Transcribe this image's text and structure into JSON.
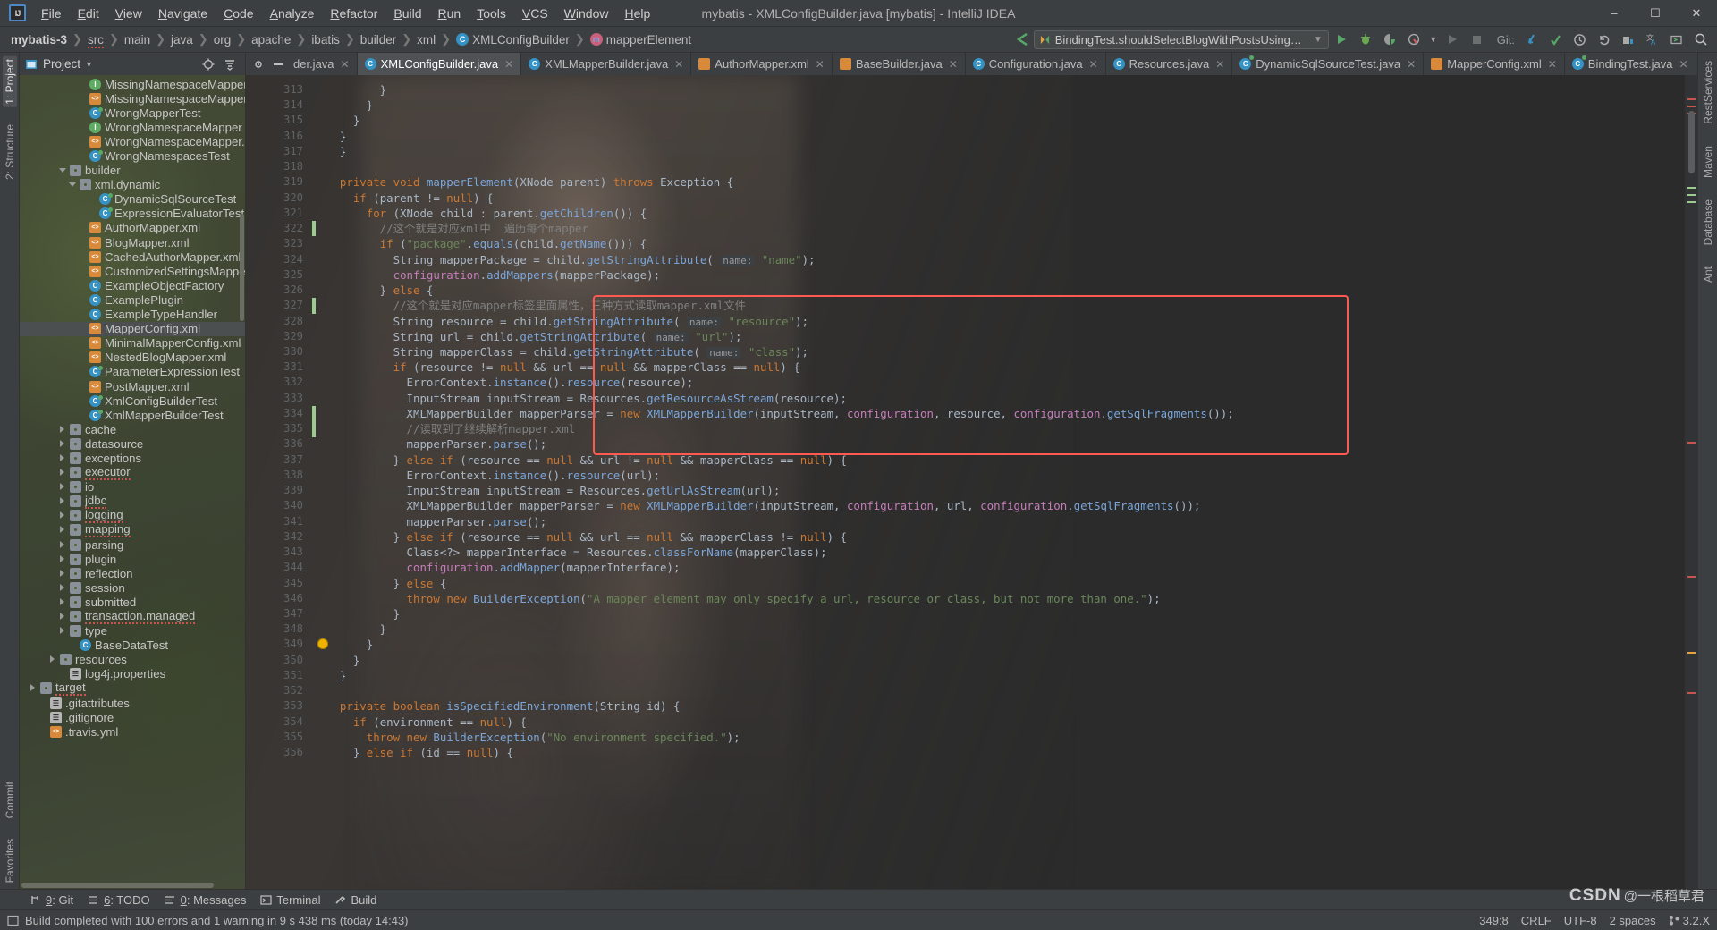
{
  "window": {
    "title": "mybatis - XMLConfigBuilder.java [mybatis] - IntelliJ IDEA",
    "minimize": "–",
    "maximize": "☐",
    "close": "✕",
    "logo": "IJ"
  },
  "menu": [
    "File",
    "Edit",
    "View",
    "Navigate",
    "Code",
    "Analyze",
    "Refactor",
    "Build",
    "Run",
    "Tools",
    "VCS",
    "Window",
    "Help"
  ],
  "breadcrumbs": [
    {
      "label": "mybatis-3",
      "type": "module"
    },
    {
      "label": "src",
      "type": "dir-underline"
    },
    {
      "label": "main",
      "type": "dir"
    },
    {
      "label": "java",
      "type": "dir"
    },
    {
      "label": "org",
      "type": "dir"
    },
    {
      "label": "apache",
      "type": "dir"
    },
    {
      "label": "ibatis",
      "type": "dir"
    },
    {
      "label": "builder",
      "type": "dir"
    },
    {
      "label": "xml",
      "type": "dir"
    },
    {
      "label": "XMLConfigBuilder",
      "type": "class"
    },
    {
      "label": "mapperElement",
      "type": "method"
    }
  ],
  "toolbar": {
    "run_configuration": "BindingTest.shouldSelectBlogWithPostsUsingSubSelect",
    "git_label": "Git:",
    "icons": [
      "run-icon",
      "debug-icon",
      "run-with-coverage-icon",
      "profile-icon",
      "rerun-icon",
      "stop-icon",
      "git-update-icon",
      "git-commit-icon",
      "git-history-icon",
      "git-rollback-icon",
      "project-structure-icon",
      "translate-icon",
      "terminal-icon",
      "search-everywhere-icon"
    ]
  },
  "left_rail": {
    "top": [
      "1: Project",
      "2: Structure"
    ],
    "bottom": [
      "Commit",
      "Favorites"
    ]
  },
  "right_rail": [
    "RestServices",
    "Maven",
    "Database",
    "Ant"
  ],
  "project_panel": {
    "title": "Project",
    "header_icons": [
      "target-icon",
      "collapse-all-icon",
      "settings-icon",
      "hide-icon"
    ],
    "tree": [
      {
        "indent": 6,
        "icon": "iface",
        "label": "MissingNamespaceMapper",
        "arrow": "",
        "selected": false
      },
      {
        "indent": 6,
        "icon": "xml",
        "label": "MissingNamespaceMapper.x",
        "arrow": "",
        "selected": false
      },
      {
        "indent": 6,
        "icon": "test",
        "label": "WrongMapperTest",
        "arrow": "",
        "selected": false
      },
      {
        "indent": 6,
        "icon": "iface",
        "label": "WrongNamespaceMapper",
        "arrow": "",
        "selected": false
      },
      {
        "indent": 6,
        "icon": "xml",
        "label": "WrongNamespaceMapper.xm",
        "arrow": "",
        "selected": false
      },
      {
        "indent": 6,
        "icon": "test",
        "label": "WrongNamespacesTest",
        "arrow": "",
        "selected": false
      },
      {
        "indent": 4,
        "icon": "folder",
        "label": "builder",
        "arrow": "d",
        "selected": false
      },
      {
        "indent": 5,
        "icon": "folder",
        "label": "xml.dynamic",
        "arrow": "d",
        "selected": false
      },
      {
        "indent": 7,
        "icon": "test",
        "label": "DynamicSqlSourceTest",
        "arrow": "",
        "selected": false
      },
      {
        "indent": 7,
        "icon": "test",
        "label": "ExpressionEvaluatorTest",
        "arrow": "",
        "selected": false
      },
      {
        "indent": 6,
        "icon": "xml",
        "label": "AuthorMapper.xml",
        "arrow": "",
        "selected": false
      },
      {
        "indent": 6,
        "icon": "xml",
        "label": "BlogMapper.xml",
        "arrow": "",
        "selected": false
      },
      {
        "indent": 6,
        "icon": "xml",
        "label": "CachedAuthorMapper.xml",
        "arrow": "",
        "selected": false
      },
      {
        "indent": 6,
        "icon": "xml",
        "label": "CustomizedSettingsMapperC",
        "arrow": "",
        "selected": false
      },
      {
        "indent": 6,
        "icon": "cls",
        "label": "ExampleObjectFactory",
        "arrow": "",
        "selected": false
      },
      {
        "indent": 6,
        "icon": "cls",
        "label": "ExamplePlugin",
        "arrow": "",
        "selected": false
      },
      {
        "indent": 6,
        "icon": "cls",
        "label": "ExampleTypeHandler",
        "arrow": "",
        "selected": false
      },
      {
        "indent": 6,
        "icon": "xml",
        "label": "MapperConfig.xml",
        "arrow": "",
        "selected": true
      },
      {
        "indent": 6,
        "icon": "xml",
        "label": "MinimalMapperConfig.xml",
        "arrow": "",
        "selected": false
      },
      {
        "indent": 6,
        "icon": "xml",
        "label": "NestedBlogMapper.xml",
        "arrow": "",
        "selected": false
      },
      {
        "indent": 6,
        "icon": "test",
        "label": "ParameterExpressionTest",
        "arrow": "",
        "selected": false
      },
      {
        "indent": 6,
        "icon": "xml",
        "label": "PostMapper.xml",
        "arrow": "",
        "selected": false
      },
      {
        "indent": 6,
        "icon": "test",
        "label": "XmlConfigBuilderTest",
        "arrow": "",
        "selected": false
      },
      {
        "indent": 6,
        "icon": "test",
        "label": "XmlMapperBuilderTest",
        "arrow": "",
        "selected": false
      },
      {
        "indent": 4,
        "icon": "folder",
        "label": "cache",
        "arrow": "r",
        "selected": false
      },
      {
        "indent": 4,
        "icon": "folder",
        "label": "datasource",
        "arrow": "r",
        "selected": false
      },
      {
        "indent": 4,
        "icon": "folder",
        "label": "exceptions",
        "arrow": "r",
        "selected": false
      },
      {
        "indent": 4,
        "icon": "folder",
        "label": "executor",
        "arrow": "r",
        "selected": false,
        "squiggle": true
      },
      {
        "indent": 4,
        "icon": "folder",
        "label": "io",
        "arrow": "r",
        "selected": false
      },
      {
        "indent": 4,
        "icon": "folder",
        "label": "jdbc",
        "arrow": "r",
        "selected": false,
        "squiggle": true
      },
      {
        "indent": 4,
        "icon": "folder",
        "label": "logging",
        "arrow": "r",
        "selected": false,
        "squiggle": true
      },
      {
        "indent": 4,
        "icon": "folder",
        "label": "mapping",
        "arrow": "r",
        "selected": false,
        "squiggle": true
      },
      {
        "indent": 4,
        "icon": "folder",
        "label": "parsing",
        "arrow": "r",
        "selected": false
      },
      {
        "indent": 4,
        "icon": "folder",
        "label": "plugin",
        "arrow": "r",
        "selected": false
      },
      {
        "indent": 4,
        "icon": "folder",
        "label": "reflection",
        "arrow": "r",
        "selected": false
      },
      {
        "indent": 4,
        "icon": "folder",
        "label": "session",
        "arrow": "r",
        "selected": false
      },
      {
        "indent": 4,
        "icon": "folder",
        "label": "submitted",
        "arrow": "r",
        "selected": false
      },
      {
        "indent": 4,
        "icon": "folder",
        "label": "transaction.managed",
        "arrow": "r",
        "selected": false,
        "squiggle": true
      },
      {
        "indent": 4,
        "icon": "folder",
        "label": "type",
        "arrow": "r",
        "selected": false
      },
      {
        "indent": 5,
        "icon": "cls",
        "label": "BaseDataTest",
        "arrow": "",
        "selected": false
      },
      {
        "indent": 3,
        "icon": "folder",
        "label": "resources",
        "arrow": "r",
        "selected": false
      },
      {
        "indent": 4,
        "icon": "props",
        "label": "log4j.properties",
        "arrow": "",
        "selected": false
      },
      {
        "indent": 1,
        "icon": "folder",
        "label": "target",
        "arrow": "r",
        "selected": false,
        "squiggle": true
      },
      {
        "indent": 2,
        "icon": "props",
        "label": ".gitattributes",
        "arrow": "",
        "selected": false
      },
      {
        "indent": 2,
        "icon": "props",
        "label": ".gitignore",
        "arrow": "",
        "selected": false
      },
      {
        "indent": 2,
        "icon": "xml",
        "label": ".travis.yml",
        "arrow": "",
        "selected": false
      }
    ]
  },
  "editor_tabs": [
    {
      "label": "der.java",
      "icon": "cls",
      "active": false,
      "partial": true
    },
    {
      "label": "XMLConfigBuilder.java",
      "icon": "cls",
      "active": true
    },
    {
      "label": "XMLMapperBuilder.java",
      "icon": "cls",
      "active": false
    },
    {
      "label": "AuthorMapper.xml",
      "icon": "xml",
      "active": false
    },
    {
      "label": "BaseBuilder.java",
      "icon": "xml",
      "active": false
    },
    {
      "label": "Configuration.java",
      "icon": "cls",
      "active": false
    },
    {
      "label": "Resources.java",
      "icon": "cls",
      "active": false
    },
    {
      "label": "DynamicSqlSourceTest.java",
      "icon": "test",
      "active": false
    },
    {
      "label": "MapperConfig.xml",
      "icon": "xml",
      "active": false
    },
    {
      "label": "BindingTest.java",
      "icon": "test",
      "active": false
    }
  ],
  "editor": {
    "first_line": 313,
    "lines": [
      {
        "n": 313,
        "text": "        }"
      },
      {
        "n": 314,
        "text": "      }"
      },
      {
        "n": 315,
        "text": "    }"
      },
      {
        "n": 316,
        "text": "  }"
      },
      {
        "n": 317,
        "text": "  }"
      },
      {
        "n": 318,
        "text": ""
      },
      {
        "n": 319,
        "text": "  private void mapperElement(XNode parent) throws Exception {"
      },
      {
        "n": 320,
        "text": "    if (parent != null) {"
      },
      {
        "n": 321,
        "text": "      for (XNode child : parent.getChildren()) {"
      },
      {
        "n": 322,
        "text": "        //这个就是对应xml中  遍历每个mapper"
      },
      {
        "n": 323,
        "text": "        if (\"package\".equals(child.getName())) {"
      },
      {
        "n": 324,
        "text": "          String mapperPackage = child.getStringAttribute( name: \"name\");"
      },
      {
        "n": 325,
        "text": "          configuration.addMappers(mapperPackage);"
      },
      {
        "n": 326,
        "text": "        } else {"
      },
      {
        "n": 327,
        "text": "          //这个就是对应mapper标签里面属性，三种方式读取mapper.xml文件"
      },
      {
        "n": 328,
        "text": "          String resource = child.getStringAttribute( name: \"resource\");"
      },
      {
        "n": 329,
        "text": "          String url = child.getStringAttribute( name: \"url\");"
      },
      {
        "n": 330,
        "text": "          String mapperClass = child.getStringAttribute( name: \"class\");"
      },
      {
        "n": 331,
        "text": "          if (resource != null && url == null && mapperClass == null) {"
      },
      {
        "n": 332,
        "text": "            ErrorContext.instance().resource(resource);"
      },
      {
        "n": 333,
        "text": "            InputStream inputStream = Resources.getResourceAsStream(resource);"
      },
      {
        "n": 334,
        "text": "            XMLMapperBuilder mapperParser = new XMLMapperBuilder(inputStream, configuration, resource, configuration.getSqlFragments());"
      },
      {
        "n": 335,
        "text": "            //读取到了继续解析mapper.xml"
      },
      {
        "n": 336,
        "text": "            mapperParser.parse();"
      },
      {
        "n": 337,
        "text": "          } else if (resource == null && url != null && mapperClass == null) {"
      },
      {
        "n": 338,
        "text": "            ErrorContext.instance().resource(url);"
      },
      {
        "n": 339,
        "text": "            InputStream inputStream = Resources.getUrlAsStream(url);"
      },
      {
        "n": 340,
        "text": "            XMLMapperBuilder mapperParser = new XMLMapperBuilder(inputStream, configuration, url, configuration.getSqlFragments());"
      },
      {
        "n": 341,
        "text": "            mapperParser.parse();"
      },
      {
        "n": 342,
        "text": "          } else if (resource == null && url == null && mapperClass != null) {"
      },
      {
        "n": 343,
        "text": "            Class<?> mapperInterface = Resources.classForName(mapperClass);"
      },
      {
        "n": 344,
        "text": "            configuration.addMapper(mapperInterface);"
      },
      {
        "n": 345,
        "text": "          } else {"
      },
      {
        "n": 346,
        "text": "            throw new BuilderException(\"A mapper element may only specify a url, resource or class, but not more than one.\");"
      },
      {
        "n": 347,
        "text": "          }"
      },
      {
        "n": 348,
        "text": "        }"
      },
      {
        "n": 349,
        "text": "      }"
      },
      {
        "n": 350,
        "text": "    }"
      },
      {
        "n": 351,
        "text": "  }"
      },
      {
        "n": 352,
        "text": ""
      },
      {
        "n": 353,
        "text": "  private boolean isSpecifiedEnvironment(String id) {"
      },
      {
        "n": 354,
        "text": "    if (environment == null) {"
      },
      {
        "n": 355,
        "text": "      throw new BuilderException(\"No environment specified.\");"
      },
      {
        "n": 356,
        "text": "    } else if (id == null) {"
      }
    ],
    "highlight_box": {
      "label": "red-annotation-box",
      "color": "#ff5a52",
      "from_line": 327,
      "to_line": 336
    }
  },
  "tool_windows": [
    {
      "num": "9",
      "label": ": Git",
      "icon": "git-icon"
    },
    {
      "num": "6",
      "label": ": TODO",
      "icon": "todo-icon"
    },
    {
      "num": "0",
      "label": ": Messages",
      "icon": "messages-icon"
    },
    {
      "num": "",
      "label": "Terminal",
      "icon": "terminal-icon"
    },
    {
      "num": "",
      "label": "Build",
      "icon": "build-icon"
    }
  ],
  "status_bar": {
    "message": "Build completed with 100 errors and 1 warning in 9 s 438 ms (today 14:43)",
    "caret": "349:8",
    "line_sep": "CRLF",
    "encoding": "UTF-8",
    "indent": "2 spaces",
    "branch": "3.2.X"
  },
  "watermark": {
    "brand": "CSDN",
    "at": "@一根稻草君"
  },
  "colors": {
    "accent": "#4a88c7",
    "highlight": "#ff5a52",
    "string": "#6a8759",
    "keyword": "#cc7832"
  }
}
